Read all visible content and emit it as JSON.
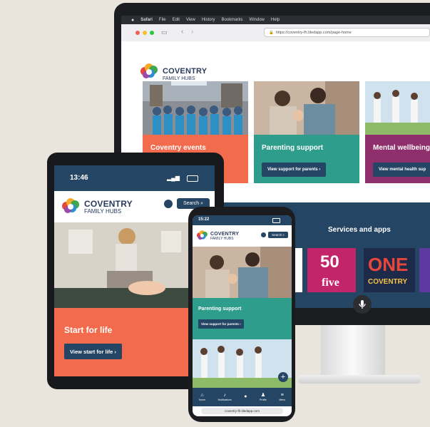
{
  "desktop": {
    "menubar": [
      "Safari",
      "File",
      "Edit",
      "View",
      "History",
      "Bookmarks",
      "Window",
      "Help"
    ],
    "url": "https://coventry-fh.tiledapp.com/page-home",
    "logo_title": "COVENTRY",
    "logo_subtitle": "FAMILY HUBS",
    "cards": [
      {
        "title": "Coventry events",
        "button": ""
      },
      {
        "title": "Parenting support",
        "button": "View support for parents ›"
      },
      {
        "title": "Mental wellbeing",
        "button": "View mental health sup"
      }
    ],
    "services_title": "Services and apps",
    "app_tiles": [
      "50",
      "five",
      "ONE",
      "COVENTRY"
    ]
  },
  "tablet": {
    "time": "13:46",
    "logo_title": "COVENTRY",
    "logo_subtitle": "FAMILY HUBS",
    "search_label": "Search",
    "card_title": "Start for life",
    "card_button": "View start for life ›"
  },
  "phone": {
    "time": "15:22",
    "logo_title": "COVENTRY",
    "logo_subtitle": "FAMILY HUBS",
    "search_label": "Search",
    "card_title": "Parenting support",
    "card_button": "View support for parents ›",
    "nav": [
      "Home",
      "Notifications",
      "",
      "Profile",
      "Menu"
    ],
    "url": "coventry-fh.tiledapp.com"
  },
  "colors": {
    "navy": "#254564",
    "orange": "#f26b4c",
    "teal": "#2f9d8c",
    "purple": "#8f2f6b",
    "pink": "#c3256b"
  }
}
